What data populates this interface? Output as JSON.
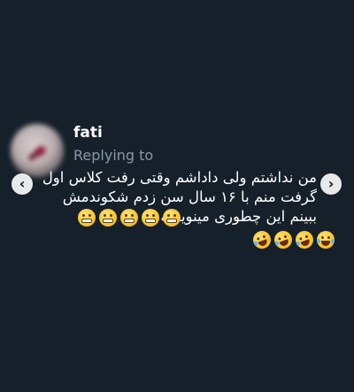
{
  "reply": {
    "username": "fati",
    "replying_label": "Replying to",
    "lines": [
      "من نداشتم ولی داداشم وقتی رفت کلاس اول",
      "گرفت منم با ۱۶ سال سن  زدم شکوندمش",
      "ببینم این چطوری مینویسه"
    ]
  },
  "emojis": {
    "row1": [
      "grimacing-face",
      "grimacing-face",
      "grimacing-face",
      "grimacing-face",
      "grimacing-face"
    ],
    "row2": [
      "rolling-on-floor-laughing",
      "rolling-on-floor-laughing",
      "rolling-on-floor-laughing",
      "face-with-tears-of-joy"
    ]
  },
  "nav": {
    "left_icon": "chevron-left-icon",
    "right_icon": "chevron-right-icon"
  },
  "colors": {
    "background": "#15202b",
    "secondary_text": "#8b98a5",
    "primary_text": "#ffffff"
  }
}
